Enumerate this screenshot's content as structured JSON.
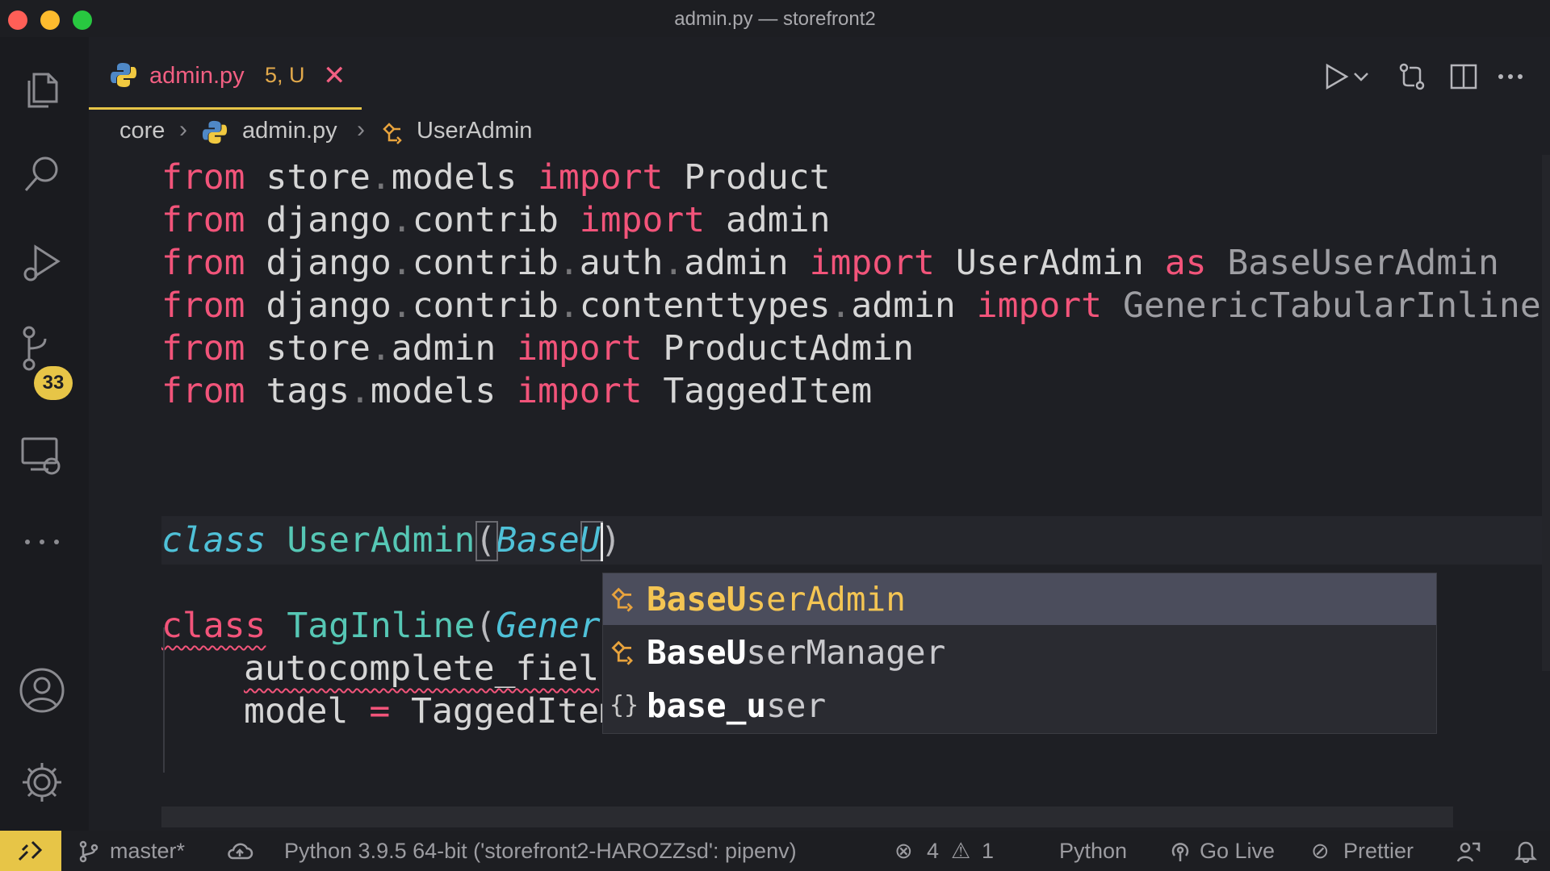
{
  "window": {
    "title": "admin.py — storefront2"
  },
  "activity": {
    "scm_badge": "33"
  },
  "tab": {
    "name": "admin.py",
    "status": "5, U",
    "close": "✕"
  },
  "breadcrumb": {
    "folder": "core",
    "file": "admin.py",
    "symbol": "UserAdmin"
  },
  "code": {
    "kw_from": "from",
    "kw_import": "import",
    "kw_as": "as",
    "kw_class": "class",
    "l1": {
      "mod1": "store",
      "mod2": "models",
      "name": "Product"
    },
    "l2": {
      "mod1": "django",
      "mod2": "contrib",
      "name": "admin"
    },
    "l3": {
      "mod1": "django",
      "mod2": "contrib",
      "mod3": "auth",
      "mod4": "admin",
      "name": "UserAdmin",
      "alias": "BaseUserAdmin"
    },
    "l4": {
      "mod1": "django",
      "mod2": "contrib",
      "mod3": "contenttypes",
      "mod4": "admin",
      "name": "GenericTabularInline"
    },
    "l5": {
      "mod1": "store",
      "mod2": "admin",
      "name": "ProductAdmin"
    },
    "l6": {
      "mod1": "tags",
      "mod2": "models",
      "name": "TaggedItem"
    },
    "l8": {
      "cls": "UserAdmin",
      "base": "BaseU"
    },
    "l10": {
      "cls": "TagInline",
      "base": "Gener"
    },
    "l11": {
      "attr": "autocomplete_fiel"
    },
    "l12": {
      "attr": "model",
      "eq": "=",
      "value": "TaggedItem"
    }
  },
  "suggest": [
    {
      "match": "BaseU",
      "rest": "serAdmin",
      "kind": "class"
    },
    {
      "match": "BaseU",
      "rest": "serManager",
      "kind": "class"
    },
    {
      "match": "base_u",
      "rest": "ser",
      "kind": "module"
    }
  ],
  "status": {
    "branch": "master*",
    "interpreter": "Python 3.9.5 64-bit ('storefront2-HAROZZsd': pipenv)",
    "errors": "4",
    "warnings": "1",
    "language": "Python",
    "golive": "Go Live",
    "prettier": "Prettier"
  }
}
